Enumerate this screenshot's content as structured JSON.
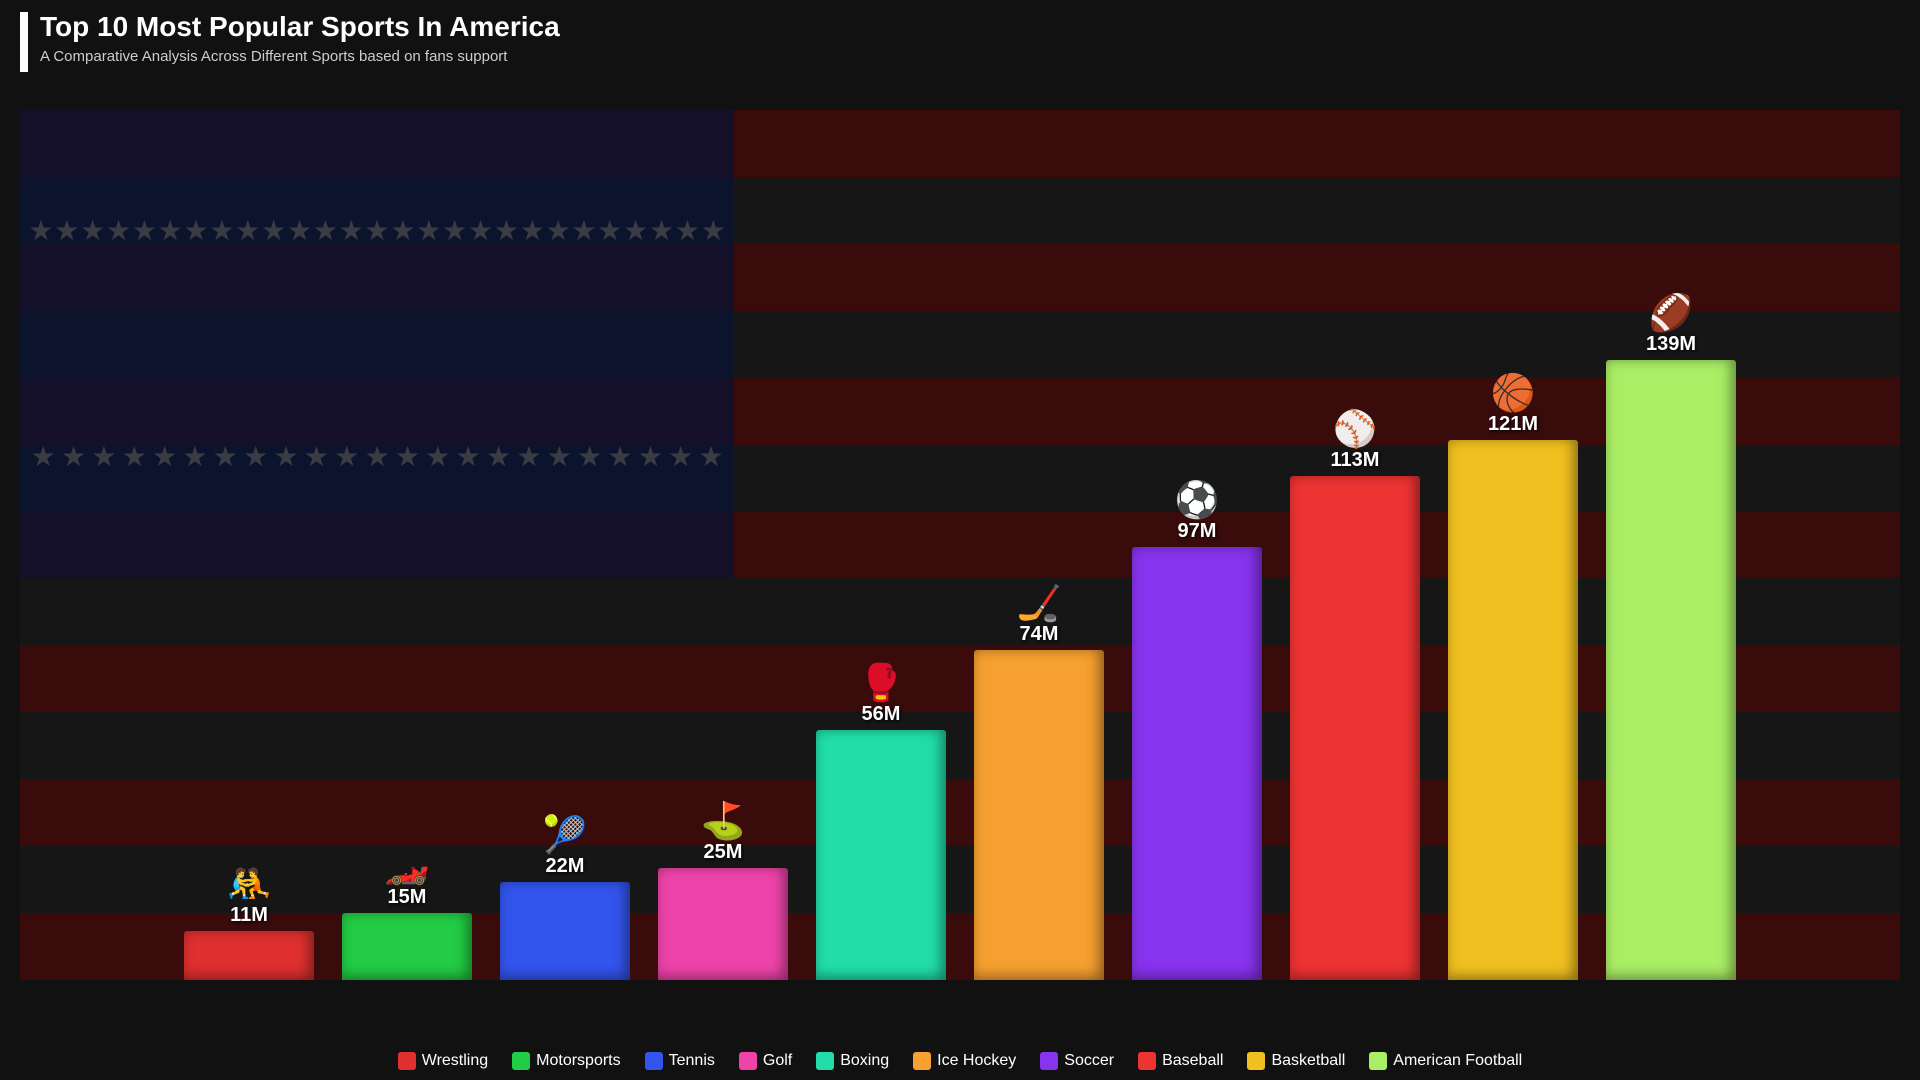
{
  "header": {
    "title": "Top 10 Most Popular Sports In America",
    "subtitle": "A Comparative Analysis Across Different Sports based on fans support"
  },
  "chart": {
    "bars": [
      {
        "id": "wrestling",
        "label": "Wrestling",
        "value": 11,
        "valueLabel": "11M",
        "color": "#e03030",
        "icon": "🤼",
        "iconType": "emoji"
      },
      {
        "id": "motorsports",
        "label": "Motorsports",
        "value": 15,
        "valueLabel": "15M",
        "color": "#22cc44",
        "icon": "🏎️",
        "iconType": "emoji"
      },
      {
        "id": "tennis",
        "label": "Tennis",
        "value": 22,
        "valueLabel": "22M",
        "color": "#3355ee",
        "icon": "🎾",
        "iconType": "emoji"
      },
      {
        "id": "golf",
        "label": "Golf",
        "value": 25,
        "valueLabel": "25M",
        "color": "#ee44aa",
        "icon": "⛳",
        "iconType": "emoji"
      },
      {
        "id": "boxing",
        "label": "Boxing",
        "value": 56,
        "valueLabel": "56M",
        "color": "#22ddaa",
        "icon": "🥊",
        "iconType": "emoji"
      },
      {
        "id": "icehockey",
        "label": "Ice Hockey",
        "value": 74,
        "valueLabel": "74M",
        "color": "#f5a030",
        "icon": "🏒",
        "iconType": "emoji"
      },
      {
        "id": "soccer",
        "label": "Soccer",
        "value": 97,
        "valueLabel": "97M",
        "color": "#8833ee",
        "icon": "⚽",
        "iconType": "emoji"
      },
      {
        "id": "baseball",
        "label": "Baseball",
        "value": 113,
        "valueLabel": "113M",
        "color": "#ee3333",
        "icon": "⚾",
        "iconType": "emoji"
      },
      {
        "id": "basketball",
        "label": "Basketball",
        "value": 121,
        "valueLabel": "121M",
        "color": "#f0c020",
        "icon": "🏀",
        "iconType": "emoji"
      },
      {
        "id": "americanfootball",
        "label": "American Football",
        "value": 139,
        "valueLabel": "139M",
        "color": "#aaee66",
        "icon": "🏈",
        "iconType": "emoji"
      }
    ],
    "maxValue": 139
  },
  "legend": {
    "items": [
      {
        "id": "wrestling",
        "label": "Wrestling",
        "color": "#e03030"
      },
      {
        "id": "motorsports",
        "label": "Motorsports",
        "color": "#22cc44"
      },
      {
        "id": "tennis",
        "label": "Tennis",
        "color": "#3355ee"
      },
      {
        "id": "golf",
        "label": "Golf",
        "color": "#ee44aa"
      },
      {
        "id": "boxing",
        "label": "Boxing",
        "color": "#22ddaa"
      },
      {
        "id": "icehockey",
        "label": "Ice Hockey",
        "color": "#f5a030"
      },
      {
        "id": "soccer",
        "label": "Soccer",
        "color": "#8833ee"
      },
      {
        "id": "baseball",
        "label": "Baseball",
        "color": "#ee3333"
      },
      {
        "id": "basketball",
        "label": "Basketball",
        "color": "#f0c020"
      },
      {
        "id": "americanfootball",
        "label": "American Football",
        "color": "#aaee66"
      }
    ]
  }
}
